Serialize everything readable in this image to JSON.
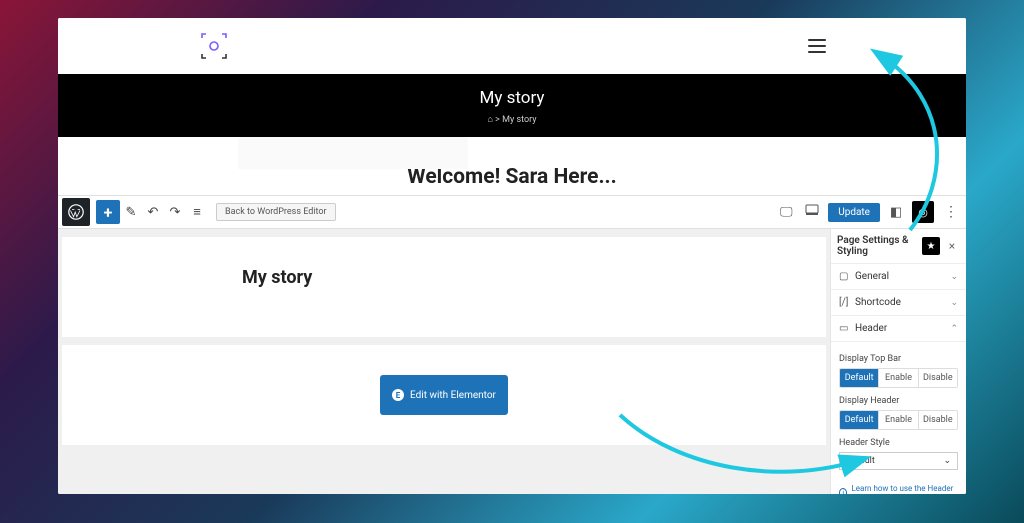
{
  "frontend": {
    "hero_title": "My story",
    "breadcrumb_home": "⌂",
    "breadcrumb_sep": ">",
    "breadcrumb_current": "My story",
    "welcome": "Welcome! Sara Here..."
  },
  "editor": {
    "back_button": "Back to WordPress Editor",
    "update_button": "Update",
    "page_title": "My story",
    "edit_button": "Edit with Elementor"
  },
  "sidebar": {
    "title": "Page Settings & Styling",
    "sections": {
      "general": "General",
      "shortcode": "Shortcode",
      "header": "Header"
    },
    "display_top_bar_label": "Display Top Bar",
    "display_header_label": "Display Header",
    "header_style_label": "Header Style",
    "options": {
      "default": "Default",
      "enable": "Enable",
      "disable": "Disable"
    },
    "header_style_value": "Default",
    "learn_text": "Learn how to use the Header settings"
  }
}
